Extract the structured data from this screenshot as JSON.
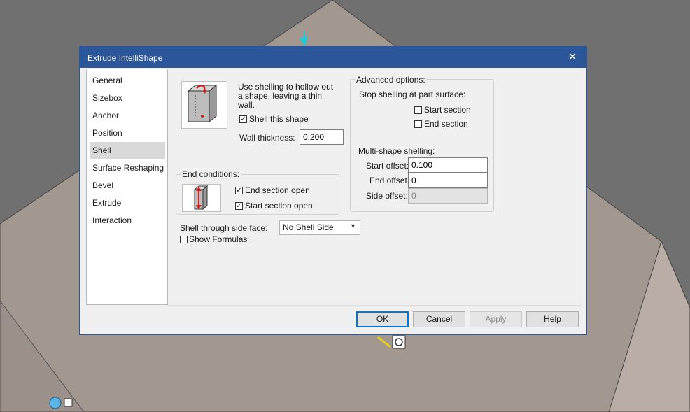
{
  "dialog": {
    "title": "Extrude IntelliShape",
    "close_glyph": "✕"
  },
  "nav": {
    "items": [
      {
        "label": "General"
      },
      {
        "label": "Sizebox"
      },
      {
        "label": "Anchor"
      },
      {
        "label": "Position"
      },
      {
        "label": "Shell",
        "active": true
      },
      {
        "label": "Surface Reshaping"
      },
      {
        "label": "Bevel"
      },
      {
        "label": "Extrude"
      },
      {
        "label": "Interaction"
      }
    ]
  },
  "shell": {
    "description": "Use shelling to hollow out a shape, leaving a thin wall.",
    "shell_this_shape_label": "Shell this shape",
    "shell_this_shape_checked": true,
    "wall_thickness_label": "Wall thickness:",
    "wall_thickness_value": "0.200",
    "end_conditions_title": "End conditions:",
    "end_section_open_label": "End section open",
    "end_section_open_checked": true,
    "start_section_open_label": "Start section open",
    "start_section_open_checked": true,
    "shell_through_label": "Shell through side face:",
    "shell_through_value": "No Shell Side",
    "show_formulas_label": "Show Formulas",
    "show_formulas_checked": false
  },
  "advanced": {
    "title": "Advanced options:",
    "stop_label": "Stop shelling at part surface:",
    "start_section_label": "Start section",
    "start_section_checked": false,
    "end_section_label": "End section",
    "end_section_checked": false,
    "multi_label": "Multi-shape shelling:",
    "start_offset_label": "Start offset:",
    "start_offset_value": "0.100",
    "end_offset_label": "End offset:",
    "end_offset_value": "0",
    "side_offset_label": "Side offset:",
    "side_offset_value": "0"
  },
  "buttons": {
    "ok": "OK",
    "cancel": "Cancel",
    "apply": "Apply",
    "help": "Help"
  },
  "colors": {
    "accent": "#2b579a",
    "background_part": "#a39890",
    "background_viewport": "#6f6f6f"
  }
}
